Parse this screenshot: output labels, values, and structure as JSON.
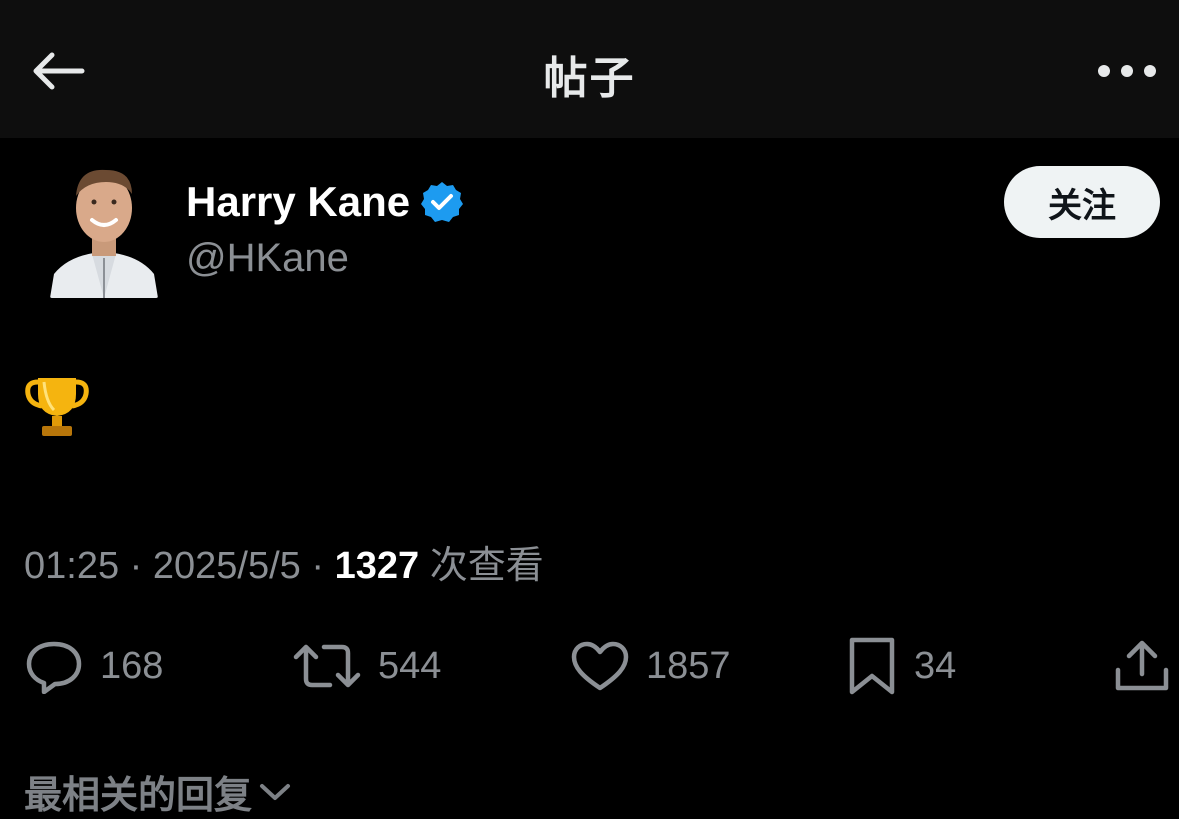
{
  "header": {
    "title": "帖子",
    "back_icon": "arrow-left-icon",
    "more_icon": "more-horizontal-icon"
  },
  "author": {
    "display_name": "Harry Kane",
    "handle": "@HKane",
    "verified": true,
    "verified_color": "#1d9bf0"
  },
  "follow_button": {
    "label": "关注"
  },
  "post": {
    "content_emoji": "trophy-icon"
  },
  "meta": {
    "time": "01:25",
    "separator": "·",
    "date": "2025/5/5",
    "views_count": "1327",
    "views_label": "次查看"
  },
  "actions": {
    "replies": "168",
    "reposts": "544",
    "likes": "1857",
    "bookmarks": "34"
  },
  "replies_sort": {
    "label": "最相关的回复"
  },
  "colors": {
    "background": "#000000",
    "header_bg": "#0e0e0e",
    "muted_text": "#8b8f94",
    "primary_text": "#e7e9ea"
  }
}
